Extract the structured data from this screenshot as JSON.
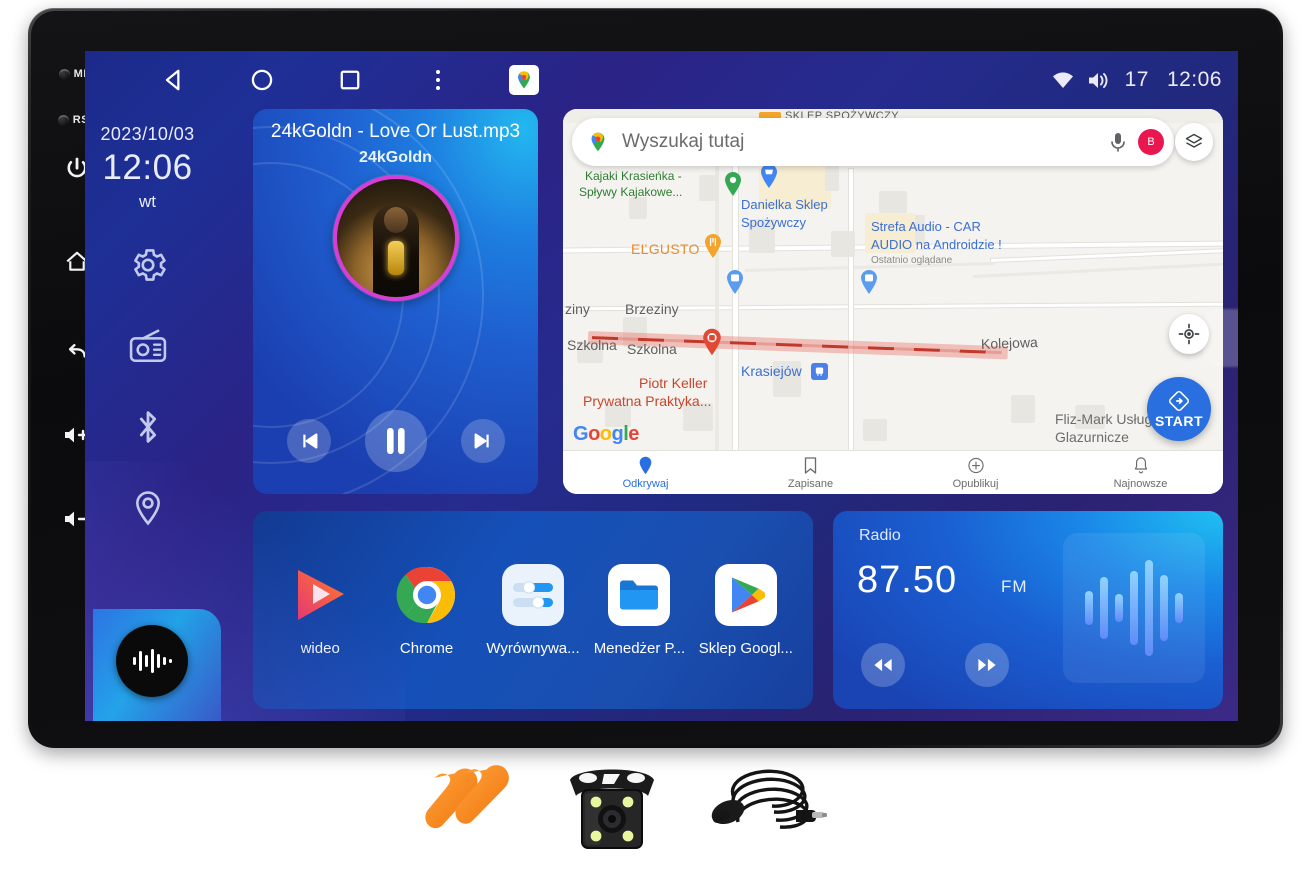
{
  "device": {
    "hardware_buttons": [
      {
        "name": "mic-led",
        "label": "MIC"
      },
      {
        "name": "rst-led",
        "label": "RST"
      },
      {
        "name": "power",
        "label": "power-icon"
      },
      {
        "name": "home",
        "label": "home-icon"
      },
      {
        "name": "back",
        "label": "back-arrow-icon"
      },
      {
        "name": "volume-up",
        "label": "volume-up-icon"
      },
      {
        "name": "volume-down",
        "label": "volume-down-icon"
      }
    ]
  },
  "statusbar": {
    "nav": [
      {
        "name": "back-button",
        "icon": "triangle-left-icon"
      },
      {
        "name": "home-button",
        "icon": "circle-icon"
      },
      {
        "name": "recents-button",
        "icon": "square-icon"
      },
      {
        "name": "overflow-button",
        "icon": "three-dots-icon"
      },
      {
        "name": "maps-shortcut",
        "icon": "google-maps-icon"
      }
    ],
    "wifi_icon": "wifi-icon",
    "volume_icon": "speaker-icon",
    "volume_value": "17",
    "clock": "12:06"
  },
  "rail": {
    "date": "2023/10/03",
    "time": "12:06",
    "weekday": "wt",
    "items": [
      {
        "name": "settings",
        "icon": "gear-icon"
      },
      {
        "name": "radio",
        "icon": "radio-icon"
      },
      {
        "name": "bluetooth",
        "icon": "bluetooth-icon"
      },
      {
        "name": "location",
        "icon": "location-pin-icon"
      }
    ],
    "music_button_icon": "waveform-icon"
  },
  "music": {
    "title": "24kGoldn - Love Or Lust.mp3",
    "artist": "24kGoldn",
    "controls": [
      {
        "name": "previous-track",
        "icon": "skip-previous-icon"
      },
      {
        "name": "play-pause",
        "icon": "pause-icon"
      },
      {
        "name": "next-track",
        "icon": "skip-next-icon"
      }
    ]
  },
  "map": {
    "search_placeholder": "Wyszukaj tutaj",
    "mic_icon": "microphone-icon",
    "avatar_initial": "B",
    "layers_icon": "layers-icon",
    "locate_icon": "my-location-icon",
    "start_label": "START",
    "google_logo": "Google",
    "top_strip_text": "SKLEP SPOŻYWCZY",
    "labels": [
      {
        "text": "Kajaki Krasieńka -",
        "color": "green"
      },
      {
        "text": "Spływy Kajakowe...",
        "color": "green"
      },
      {
        "text": "Danielka Sklep",
        "color": "blue"
      },
      {
        "text": "Spożywczy",
        "color": "blue"
      },
      {
        "text": "Strefa Audio - CAR",
        "color": "blue"
      },
      {
        "text": "AUDIO na Androidzie !",
        "color": "blue"
      },
      {
        "text": "Ostatnio oglądane",
        "color": "sub"
      },
      {
        "text": "EĽGUSTO",
        "color": "orange"
      },
      {
        "text": "ziny",
        "color": "road"
      },
      {
        "text": "Brzeziny",
        "color": "road"
      },
      {
        "text": "Szkolna",
        "color": "road"
      },
      {
        "text": "Szkolna",
        "color": "road"
      },
      {
        "text": "Kolejowa",
        "color": "road"
      },
      {
        "text": "Piotr Keller",
        "color": "red"
      },
      {
        "text": "Prywatna Praktyka...",
        "color": "red"
      },
      {
        "text": "Krasiejów",
        "color": "blue"
      },
      {
        "text": "Fliz-Mark Usługi",
        "color": "grey"
      },
      {
        "text": "Glazurnicze",
        "color": "grey"
      }
    ],
    "bottom_nav": [
      {
        "name": "discover",
        "label": "Odkrywaj",
        "icon": "map-pin-icon",
        "active": true
      },
      {
        "name": "saved",
        "label": "Zapisane",
        "icon": "bookmark-icon",
        "active": false
      },
      {
        "name": "publish",
        "label": "Opublikuj",
        "icon": "plus-circle-icon",
        "active": false
      },
      {
        "name": "latest",
        "label": "Najnowsze",
        "icon": "bell-icon",
        "active": false
      }
    ]
  },
  "apps": [
    {
      "name": "wideo",
      "label": "wideo",
      "icon": "video-play-icon"
    },
    {
      "name": "chrome",
      "label": "Chrome",
      "icon": "chrome-icon"
    },
    {
      "name": "wyrownywanie",
      "label": "Wyrównywa...",
      "icon": "equalizer-icon"
    },
    {
      "name": "menedzer-plikow",
      "label": "Menedżer P...",
      "icon": "folder-icon"
    },
    {
      "name": "sklep-google",
      "label": "Sklep Googl...",
      "icon": "play-store-icon"
    }
  ],
  "radio": {
    "label": "Radio",
    "frequency": "87.50",
    "band": "FM",
    "prev_icon": "rewind-icon",
    "next_icon": "fast-forward-icon",
    "viz_bars": [
      34,
      62,
      28,
      74,
      96,
      66,
      30
    ]
  },
  "accessories": [
    {
      "name": "pry-tools",
      "label": "trim-removal-tools"
    },
    {
      "name": "reverse-camera",
      "label": "rear-view-camera"
    },
    {
      "name": "external-mic",
      "label": "external-microphone"
    }
  ],
  "colors": {
    "accent_blue": "#2a6fe0",
    "screen_blue": "#1e2f96",
    "card_blue": "#1550b8",
    "album_ring": "#d63fd6",
    "maps_red": "#ea4335"
  }
}
